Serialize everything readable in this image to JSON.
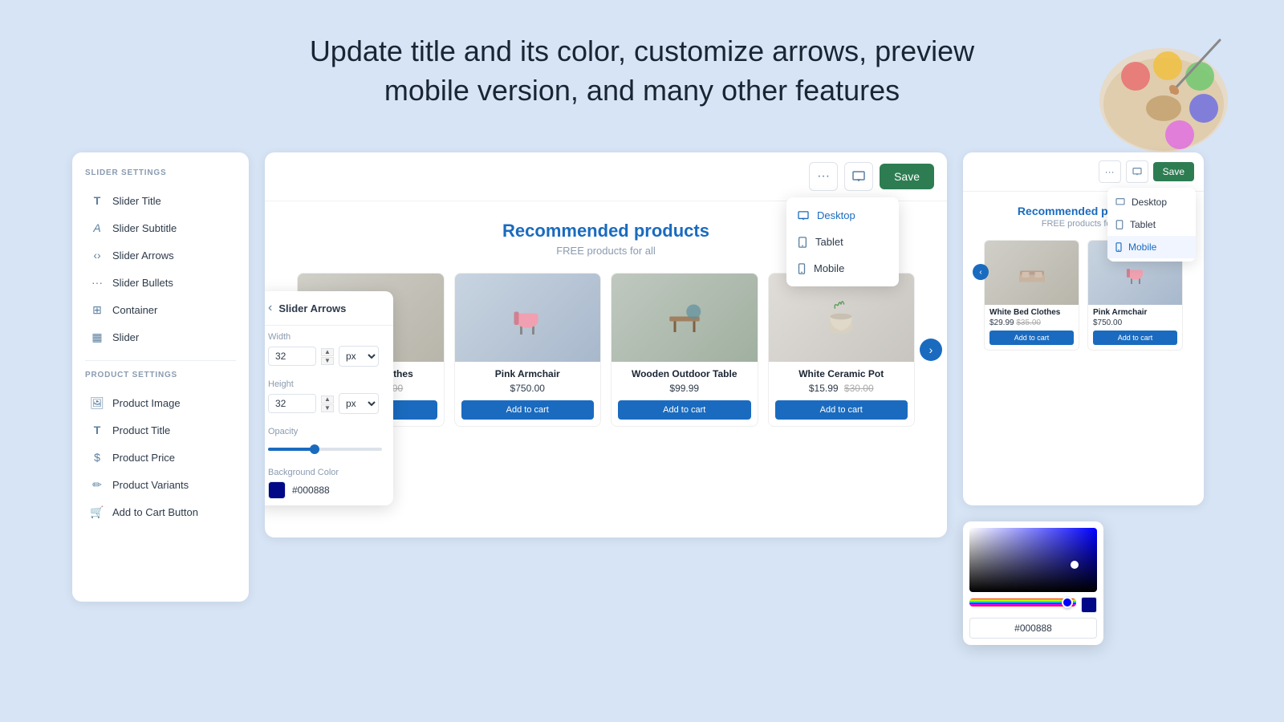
{
  "header": {
    "line1": "Update title and its color, customize arrows, preview",
    "line2": "mobile version, and many other features"
  },
  "sidebar": {
    "slider_settings_label": "SLIDER SETTINGS",
    "slider_items": [
      {
        "id": "slider-title",
        "label": "Slider Title",
        "icon": "T"
      },
      {
        "id": "slider-subtitle",
        "label": "Slider Subtitle",
        "icon": "A"
      },
      {
        "id": "slider-arrows",
        "label": "Slider Arrows",
        "icon": "‹›"
      },
      {
        "id": "slider-bullets",
        "label": "Slider Bullets",
        "icon": "···"
      },
      {
        "id": "container",
        "label": "Container",
        "icon": "⊞"
      },
      {
        "id": "slider",
        "label": "Slider",
        "icon": "▦"
      }
    ],
    "product_settings_label": "PRODUCT SETTINGS",
    "product_items": [
      {
        "id": "product-image",
        "label": "Product Image",
        "icon": "🖼"
      },
      {
        "id": "product-title",
        "label": "Product Title",
        "icon": "T"
      },
      {
        "id": "product-price",
        "label": "Product Price",
        "icon": "$"
      },
      {
        "id": "product-variants",
        "label": "Product Variants",
        "icon": "✏"
      },
      {
        "id": "add-to-cart",
        "label": "Add to Cart Button",
        "icon": "🛒"
      }
    ]
  },
  "editor": {
    "slider_title": "Recommended products",
    "slider_subtitle": "FREE products for all",
    "save_label": "Save",
    "device_dropdown": {
      "items": [
        "Desktop",
        "Tablet",
        "Mobile"
      ]
    },
    "products": [
      {
        "name": "White Bed Clothes",
        "price": "$29.99",
        "original_price": "$35.00",
        "img_class": "product-img-bed"
      },
      {
        "name": "Pink Armchair",
        "price": "$750.00",
        "original_price": "",
        "img_class": "product-img-chair"
      },
      {
        "name": "Wooden Outdoor Table",
        "price": "$99.99",
        "original_price": "",
        "img_class": "product-img-table"
      },
      {
        "name": "White Ceramic Pot",
        "price": "$15.99",
        "original_price": "$30.00",
        "img_class": "product-img-pot"
      }
    ],
    "add_to_cart_label": "Add to cart"
  },
  "arrow_popup": {
    "title": "Slider Arrows",
    "width_label": "Width",
    "width_value": "32",
    "height_label": "Height",
    "height_value": "32",
    "opacity_label": "Opacity",
    "bg_color_label": "Background Color",
    "bg_color_value": "#000888",
    "unit": "px"
  },
  "mobile_preview": {
    "save_label": "Save",
    "title": "Recommended products",
    "subtitle": "FREE products for all",
    "device_dropdown": {
      "items": [
        "Desktop",
        "Tablet",
        "Mobile"
      ]
    },
    "products": [
      {
        "name": "White Bed Clothes",
        "price": "$29.99",
        "original_price": "$35.00",
        "img_class": "product-img-bed"
      },
      {
        "name": "Pink Armchair",
        "price": "$750.00",
        "original_price": "",
        "img_class": "product-img-chair"
      }
    ]
  },
  "color_picker": {
    "hex_value": "#000888"
  }
}
